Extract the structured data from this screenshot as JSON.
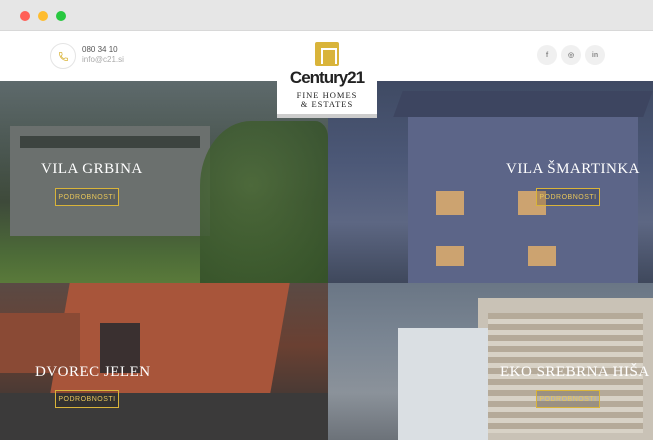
{
  "header": {
    "phone": "080 34 10",
    "email": "info@c21.si",
    "social": [
      {
        "icon": "facebook-icon",
        "glyph": "f"
      },
      {
        "icon": "instagram-icon",
        "glyph": "◎"
      },
      {
        "icon": "linkedin-icon",
        "glyph": "in"
      }
    ]
  },
  "logo": {
    "brand": "Century21",
    "tagline_line1": "FINE HOMES",
    "tagline_line2": "& ESTATES"
  },
  "projects": [
    {
      "title": "VILA GRBINA",
      "button": "PODROBNOSTI"
    },
    {
      "title": "VILA ŠMARTINKA",
      "button": "PODROBNOSTI"
    },
    {
      "title": "DVOREC JELEN",
      "button": "PODROBNOSTI"
    },
    {
      "title": "EKO SREBRNA HIŠA",
      "button": "PODROBNOSTI"
    }
  ],
  "colors": {
    "accent_gold": "#d9b43a",
    "header_bg": "#ffffff",
    "chrome_bg": "#e6e6e6"
  }
}
